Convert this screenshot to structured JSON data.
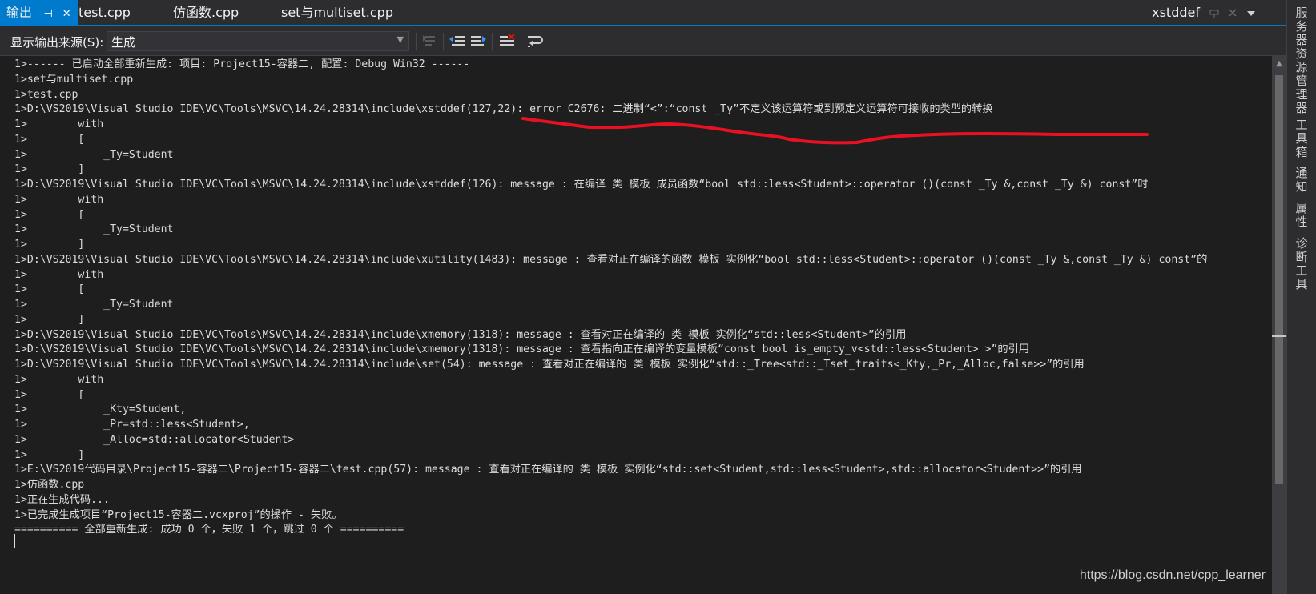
{
  "tabs": [
    {
      "label": "输出",
      "active": true,
      "pin_glyph": "⊣",
      "close_glyph": "✕"
    },
    {
      "label": "test.cpp",
      "active": false
    },
    {
      "label": "仿函数.cpp",
      "active": false
    },
    {
      "label": "set与multiset.cpp",
      "active": false
    }
  ],
  "right_tab": {
    "label": "xstddef"
  },
  "toolbar": {
    "source_label": "显示输出来源(S):",
    "source_value": "生成"
  },
  "output_lines": [
    "1>------ 已启动全部重新生成: 项目: Project15-容器二, 配置: Debug Win32 ------",
    "1>set与multiset.cpp",
    "1>test.cpp",
    "1>D:\\VS2019\\Visual Studio IDE\\VC\\Tools\\MSVC\\14.24.28314\\include\\xstddef(127,22): error C2676: 二进制“<”:“const _Ty”不定义该运算符或到预定义运算符可接收的类型的转换",
    "1>        with",
    "1>        [",
    "1>            _Ty=Student",
    "1>        ]",
    "1>D:\\VS2019\\Visual Studio IDE\\VC\\Tools\\MSVC\\14.24.28314\\include\\xstddef(126): message : 在编译 类 模板 成员函数“bool std::less<Student>::operator ()(const _Ty &,const _Ty &) const”时",
    "1>        with",
    "1>        [",
    "1>            _Ty=Student",
    "1>        ]",
    "1>D:\\VS2019\\Visual Studio IDE\\VC\\Tools\\MSVC\\14.24.28314\\include\\xutility(1483): message : 查看对正在编译的函数 模板 实例化“bool std::less<Student>::operator ()(const _Ty &,const _Ty &) const”的",
    "1>        with",
    "1>        [",
    "1>            _Ty=Student",
    "1>        ]",
    "1>D:\\VS2019\\Visual Studio IDE\\VC\\Tools\\MSVC\\14.24.28314\\include\\xmemory(1318): message : 查看对正在编译的 类 模板 实例化“std::less<Student>”的引用",
    "1>D:\\VS2019\\Visual Studio IDE\\VC\\Tools\\MSVC\\14.24.28314\\include\\xmemory(1318): message : 查看指向正在编译的变量模板“const bool is_empty_v<std::less<Student> >”的引用",
    "1>D:\\VS2019\\Visual Studio IDE\\VC\\Tools\\MSVC\\14.24.28314\\include\\set(54): message : 查看对正在编译的 类 模板 实例化“std::_Tree<std::_Tset_traits<_Kty,_Pr,_Alloc,false>>”的引用",
    "1>        with",
    "1>        [",
    "1>            _Kty=Student,",
    "1>            _Pr=std::less<Student>,",
    "1>            _Alloc=std::allocator<Student>",
    "1>        ]",
    "1>E:\\VS2019代码目录\\Project15-容器二\\Project15-容器二\\test.cpp(57): message : 查看对正在编译的 类 模板 实例化“std::set<Student,std::less<Student>,std::allocator<Student>>”的引用",
    "1>仿函数.cpp",
    "1>正在生成代码...",
    "1>已完成生成项目“Project15-容器二.vcxproj”的操作 - 失败。",
    "========== 全部重新生成: 成功 0 个，失败 1 个，跳过 0 个 =========="
  ],
  "side_panel": [
    {
      "label": "服务器资源管理器"
    },
    {
      "label": "工具箱"
    },
    {
      "label": "通知"
    },
    {
      "label": "属性"
    },
    {
      "label": "诊断工具"
    }
  ],
  "watermark": "https://blog.csdn.net/cpp_learner",
  "colors": {
    "accent": "#007acc",
    "background": "#1e1e1e",
    "chrome": "#2d2d30",
    "text": "#dcdcdc",
    "annotation": "#e81123"
  },
  "icons": [
    "pin-icon",
    "close-icon",
    "window-position-icon",
    "dropdown-chevron-icon",
    "find-message-icon",
    "previous-message-icon",
    "next-message-icon",
    "clear-all-icon",
    "toggle-word-wrap-icon"
  ]
}
